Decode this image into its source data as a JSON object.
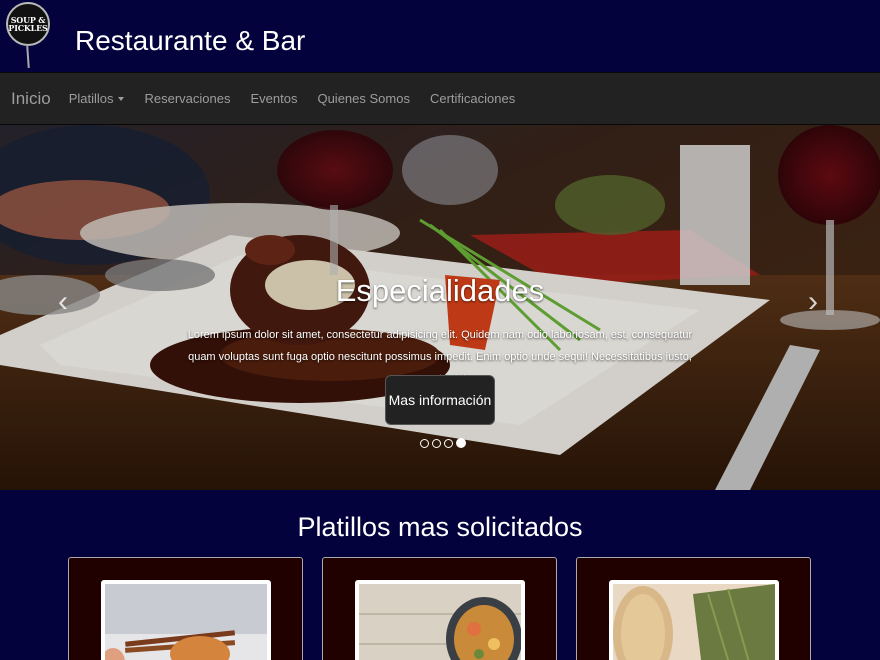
{
  "header": {
    "logo_text": "SOUP & PICKLES",
    "title": "Restaurante & Bar"
  },
  "navbar": {
    "brand": "Inicio",
    "items": [
      {
        "label": "Platillos",
        "dropdown": true
      },
      {
        "label": "Reservaciones"
      },
      {
        "label": "Eventos"
      },
      {
        "label": "Quienes Somos"
      },
      {
        "label": "Certificaciones"
      }
    ]
  },
  "carousel": {
    "title": "Especialidades",
    "text": "Lorem ipsum dolor sit amet, consectetur adipisicing elit. Quidem nam odio laboriosam, est, consequatur quam voluptas sunt fuga optio nescitunt possimus impedit. Enim optio unde sequi! Necessitatibus iusto, consequatur labore.",
    "button": "Mas información",
    "prev_icon": "chevron-left-icon",
    "next_icon": "chevron-right-icon",
    "slide_count": 4,
    "active_slide": 4
  },
  "section": {
    "title": "Platillos mas solicitados",
    "cards": [
      {
        "image": "pasta-chopsticks-photo"
      },
      {
        "image": "seafood-bowl-photo"
      },
      {
        "image": "tortillas-leaves-photo"
      }
    ]
  },
  "colors": {
    "page_bg": "#03023d",
    "navbar_bg": "#222222",
    "card_bg": "#210000"
  }
}
